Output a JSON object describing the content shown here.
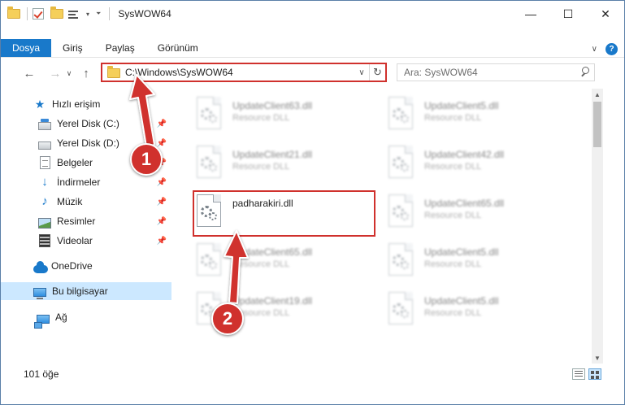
{
  "titlebar": {
    "title": "SysWOW64",
    "controls": {
      "minimize": "—",
      "maximize": "☐",
      "close": "✕"
    }
  },
  "ribbon": {
    "tabs": [
      "Dosya",
      "Giriş",
      "Paylaş",
      "Görünüm"
    ],
    "help": "?"
  },
  "nav": {
    "address": "C:\\Windows\\SysWOW64",
    "search_placeholder": "Ara: SysWOW64"
  },
  "sidebar": {
    "items": [
      {
        "label": "Hızlı erişim",
        "icon": "star-icon",
        "pinned": false
      },
      {
        "label": "Yerel Disk (C:)",
        "icon": "drive-icon",
        "pinned": true
      },
      {
        "label": "Yerel Disk (D:)",
        "icon": "drive-icon",
        "pinned": true
      },
      {
        "label": "Belgeler",
        "icon": "documents-icon",
        "pinned": true
      },
      {
        "label": "İndirmeler",
        "icon": "download-icon",
        "pinned": true
      },
      {
        "label": "Müzik",
        "icon": "music-icon",
        "pinned": true
      },
      {
        "label": "Resimler",
        "icon": "pictures-icon",
        "pinned": true
      },
      {
        "label": "Videolar",
        "icon": "videos-icon",
        "pinned": true
      },
      {
        "label": "OneDrive",
        "icon": "onedrive-icon",
        "pinned": false
      },
      {
        "label": "Bu bilgisayar",
        "icon": "this-pc-icon",
        "pinned": false
      },
      {
        "label": "Ağ",
        "icon": "network-icon",
        "pinned": false
      }
    ]
  },
  "files": [
    {
      "name": "UpdateClient63.dll",
      "type": "Resource DLL"
    },
    {
      "name": "UpdateClient5.dll",
      "type": "Resource DLL"
    },
    {
      "name": "UpdateClient21.dll",
      "type": "Resource DLL"
    },
    {
      "name": "UpdateClient42.dll",
      "type": "Resource DLL"
    },
    {
      "name": "padharakiri.dll",
      "type": ""
    },
    {
      "name": "UpdateClient65.dll",
      "type": "Resource DLL"
    },
    {
      "name": "UpdateClient65.dll",
      "type": "Resource DLL"
    },
    {
      "name": "UpdateClient5.dll",
      "type": "Resource DLL"
    },
    {
      "name": "UpdateClient19.dll",
      "type": "Resource DLL"
    },
    {
      "name": "UpdateClient5.dll",
      "type": "Resource DLL"
    }
  ],
  "status": {
    "count": "101 öğe"
  },
  "annotations": {
    "badge1": "1",
    "badge2": "2",
    "color": "#d0312d"
  }
}
